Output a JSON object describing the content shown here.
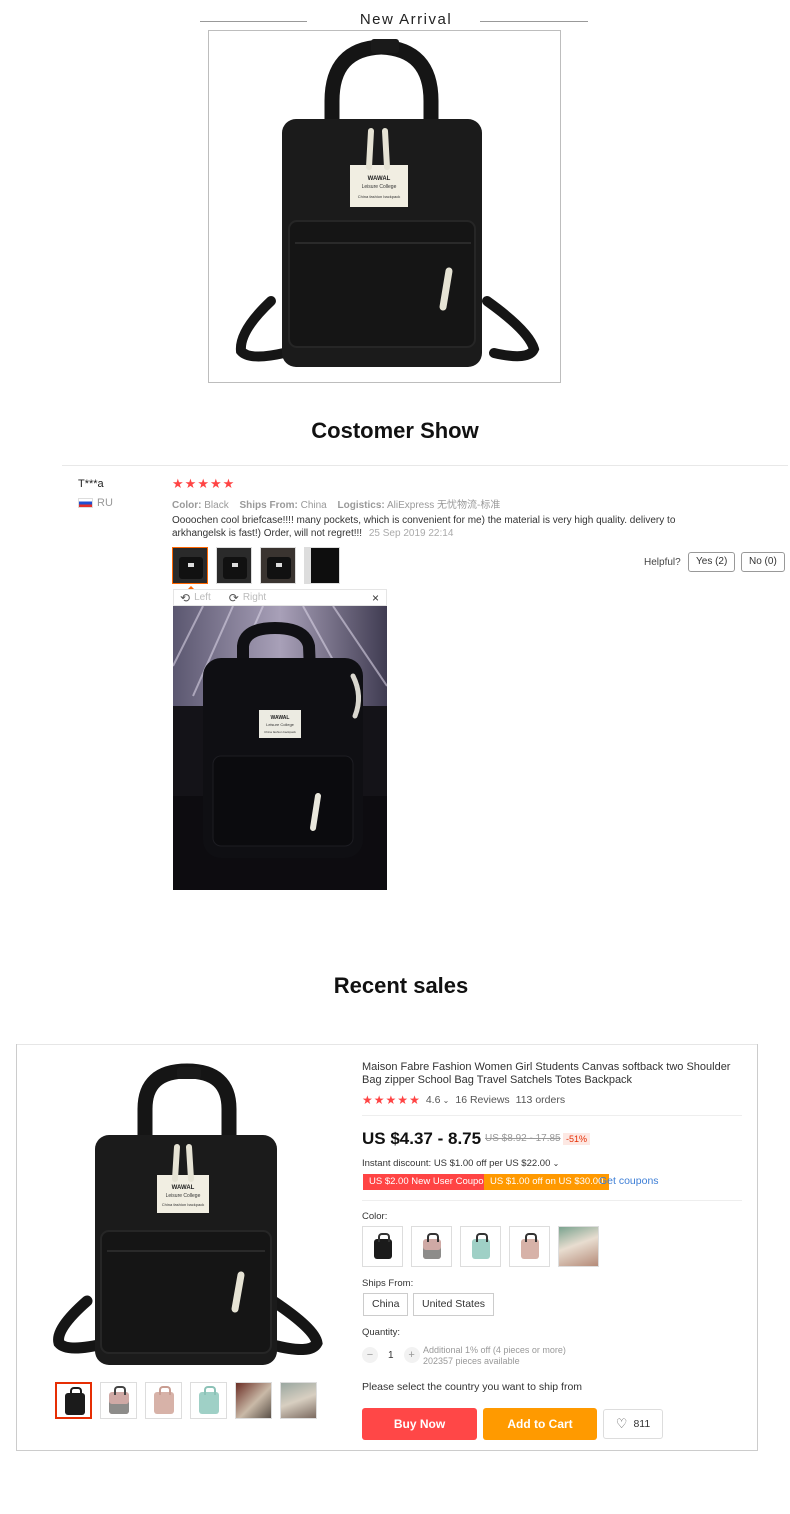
{
  "new_arrival": {
    "title": "New Arrival"
  },
  "customer_show": {
    "title": "Costomer Show",
    "review": {
      "user": "T***a",
      "country": "RU",
      "rating_stars": 5,
      "color_label": "Color:",
      "color_value": "Black",
      "ships_from_label": "Ships From:",
      "ships_from_value": "China",
      "logistics_label": "Logistics:",
      "logistics_value": "AliExpress 无忧物流-标准",
      "text": "Oooochen cool briefcase!!!! many pockets, which is convenient for me) the material is very high quality. delivery to arkhangelsk is fast!) Order, will not regret!!!",
      "date": "25 Sep 2019 22:14",
      "helpful_label": "Helpful?",
      "yes_label": "Yes (2)",
      "no_label": "No (0)",
      "viewer": {
        "left_label": "Left",
        "right_label": "Right",
        "close_icon": "×"
      }
    }
  },
  "recent_sales": {
    "title": "Recent sales",
    "product": {
      "title": "Maison Fabre Fashion Women Girl Students Canvas softback two Shoulder Bag zipper School Bag Travel Satchels Totes Backpack",
      "rating": "4.6",
      "reviews": "16 Reviews",
      "orders": "113 orders",
      "price": "US $4.37 - 8.75",
      "original_price": "US $8.92 - 17.85",
      "discount": "-51%",
      "instant_discount": "Instant discount: US $1.00 off per US $22.00",
      "coupon_1": "US $2.00 New User Coupon",
      "coupon_2": "US $1.00 off on US $30.00",
      "get_coupons": "Get coupons",
      "color_label": "Color:",
      "ships_from_label": "Ships From:",
      "ships_from_options": [
        "China",
        "United States"
      ],
      "quantity_label": "Quantity:",
      "quantity_value": "1",
      "quantity_note_1": "Additional 1% off (4 pieces or more)",
      "quantity_note_2": "202357 pieces available",
      "ship_message": "Please select the country you want to ship from",
      "buy_now": "Buy Now",
      "add_to_cart": "Add to Cart",
      "wishlist_count": "811"
    }
  },
  "colors": {
    "accent_red": "#ff4747",
    "accent_orange": "#ff9a00",
    "link_blue": "#3d7ed6"
  }
}
